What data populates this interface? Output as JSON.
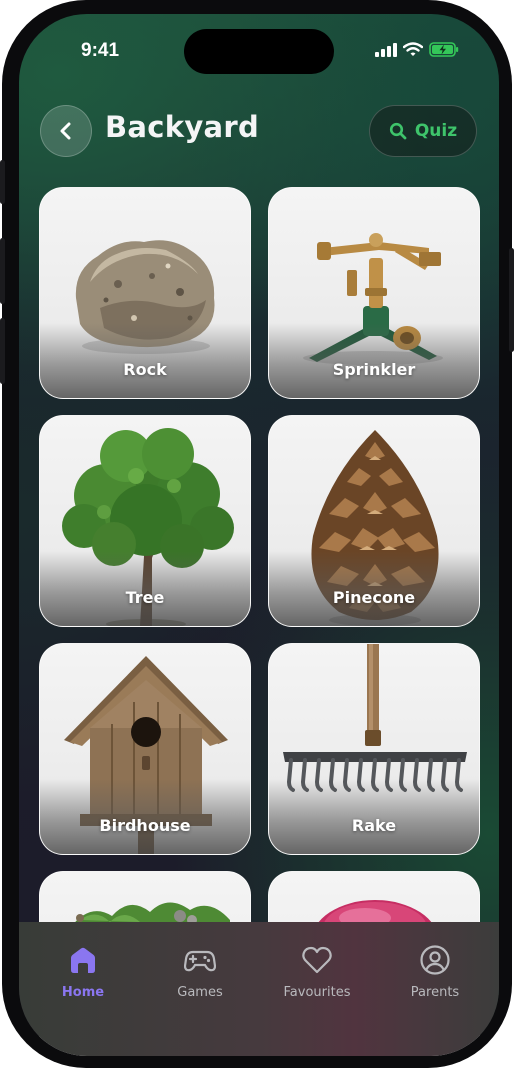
{
  "status_bar": {
    "time": "9:41"
  },
  "header": {
    "title": "Backyard",
    "quiz_label": "Quiz"
  },
  "items": [
    {
      "label": "Rock"
    },
    {
      "label": "Sprinkler"
    },
    {
      "label": "Tree"
    },
    {
      "label": "Pinecone"
    },
    {
      "label": "Birdhouse"
    },
    {
      "label": "Rake"
    }
  ],
  "nav": [
    {
      "label": "Home",
      "icon": "home-icon",
      "active": true
    },
    {
      "label": "Games",
      "icon": "gamepad-icon",
      "active": false
    },
    {
      "label": "Favourites",
      "icon": "heart-icon",
      "active": false
    },
    {
      "label": "Parents",
      "icon": "user-circle-icon",
      "active": false
    }
  ],
  "colors": {
    "accent_green": "#3ec46b",
    "nav_active": "#8a76f0",
    "nav_inactive": "#b9b9bd"
  }
}
